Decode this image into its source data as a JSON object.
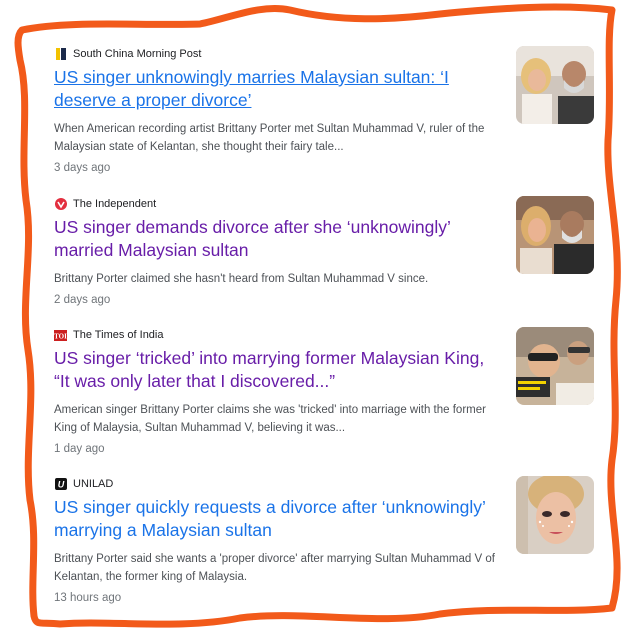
{
  "articles": [
    {
      "source": "South China Morning Post",
      "source_icon": "scmp-logo-icon",
      "title": "US singer unknowingly marries Malaysian sultan: ‘I deserve a proper divorce’",
      "snippet": "When American recording artist Brittany Porter met Sultan Muhammad V, ruler of the Malaysian state of Kelantan, she thought their fairy tale...",
      "time": "3 days ago"
    },
    {
      "source": "The Independent",
      "source_icon": "independent-logo-icon",
      "title": "US singer demands divorce after she ‘unknowingly’ married Malaysian sultan",
      "snippet": "Brittany Porter claimed she hasn't heard from Sultan Muhammad V since.",
      "time": "2 days ago"
    },
    {
      "source": "The Times of India",
      "source_icon": "toi-logo-icon",
      "title": "US singer ‘tricked’ into marrying former Malaysian King, “It was only later that I discovered...”",
      "snippet": "American singer Brittany Porter claims she was 'tricked' into marriage with the former King of Malaysia, Sultan Muhammad V, believing it was...",
      "time": "1 day ago"
    },
    {
      "source": "UNILAD",
      "source_icon": "unilad-logo-icon",
      "title": "US singer quickly requests a divorce after ‘unknowingly’ marrying a Malaysian sultan",
      "snippet": "Brittany Porter said she wants a 'proper divorce' after marrying Sultan Muhammad V of Kelantan, the former king of Malaysia.",
      "time": "13 hours ago"
    }
  ],
  "colors": {
    "frame_orange": "#f25a1a",
    "visited_link": "#681da8",
    "link": "#1a73e8",
    "snippet": "#4d5156",
    "time": "#70757a"
  },
  "toi_mark": "TOI",
  "unilad_mark": "U"
}
